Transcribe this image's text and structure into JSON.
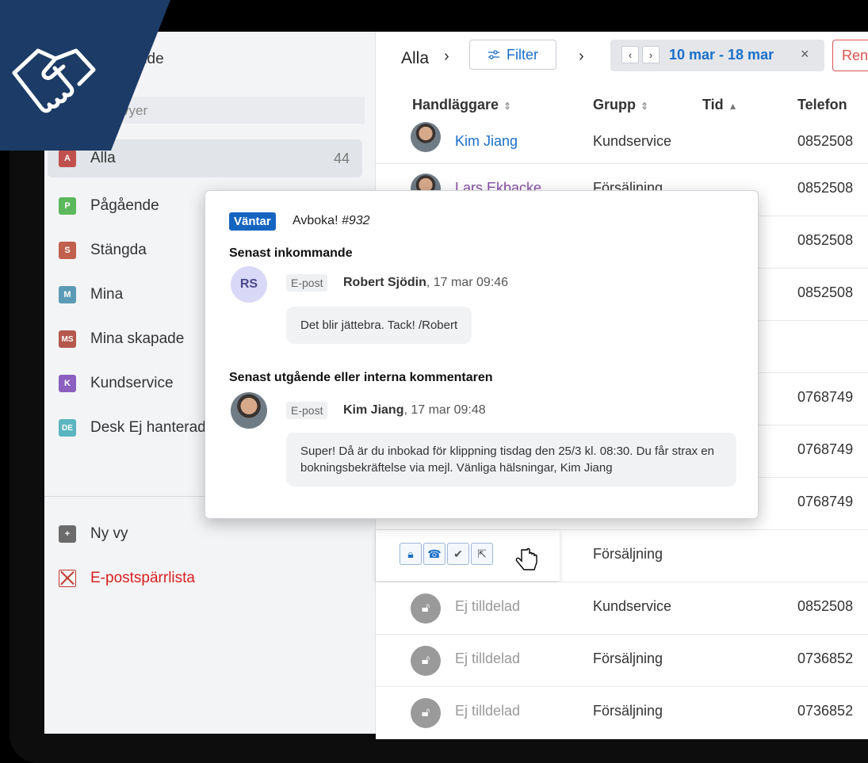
{
  "sidebar": {
    "title": "Pågående",
    "search_placeholder": "Sök vyer",
    "items": [
      {
        "badge": "A",
        "label": "Alla",
        "count": "44",
        "color": "#c0504d"
      },
      {
        "badge": "P",
        "label": "Pågående",
        "color": "#5cb85c"
      },
      {
        "badge": "S",
        "label": "Stängda",
        "color": "#c0604d"
      },
      {
        "badge": "M",
        "label": "Mina",
        "color": "#5b9bb5"
      },
      {
        "badge": "MS",
        "label": "Mina skapade",
        "color": "#b5574d"
      },
      {
        "badge": "K",
        "label": "Kundservice",
        "color": "#8a5fc0"
      },
      {
        "badge": "DE",
        "label": "Desk Ej hanterad",
        "color": "#5bb5c0"
      }
    ],
    "new_view_label": "Ny vy",
    "new_view_badge": "+",
    "blocklist_label": "E-postspärrlista"
  },
  "header": {
    "crumb": "Alla",
    "filter_label": "Filter",
    "date_range": "10 mar - 18 mar",
    "clear_label": "Rensa"
  },
  "table": {
    "columns": [
      "Handläggare",
      "Grupp",
      "Tid",
      "Telefon"
    ],
    "rows": [
      {
        "agent": "Kim Jiang",
        "group": "Kundservice",
        "phone": "0852508"
      },
      {
        "agent": "Lars Ekbacke",
        "group": "Försäljning",
        "phone": "0852508"
      },
      {
        "agent": "",
        "group": "",
        "phone": "0852508"
      },
      {
        "agent": "",
        "group": "",
        "phone": "0852508"
      },
      {
        "agent": "",
        "group": "",
        "phone": ""
      },
      {
        "agent": "",
        "group": "",
        "phone": "0768749"
      },
      {
        "agent": "",
        "group": "",
        "phone": "0768749"
      },
      {
        "agent": "",
        "group": "",
        "phone": "0768749"
      },
      {
        "agent": "",
        "group": "Försäljning",
        "phone": ""
      },
      {
        "agent": "Ej tilldelad",
        "group": "Kundservice",
        "phone": "0852508"
      },
      {
        "agent": "Ej tilldelad",
        "group": "Försäljning",
        "phone": "0736852"
      },
      {
        "agent": "Ej tilldelad",
        "group": "Försäljning",
        "phone": "0736852"
      }
    ]
  },
  "popover": {
    "status": "Väntar",
    "subject": "Avboka!",
    "ticket_no": "#932",
    "incoming_heading": "Senast inkommande",
    "incoming": {
      "initials": "RS",
      "channel": "E-post",
      "author": "Robert Sjödin",
      "time": ", 17 mar 09:46",
      "message": "Det blir jättebra. Tack!  /Robert"
    },
    "outgoing_heading": "Senast utgående eller interna kommentaren",
    "outgoing": {
      "channel": "E-post",
      "author": "Kim Jiang",
      "time": ", 17 mar 09:48",
      "message": "Super! Då är du inbokad för klippning tisdag den 25/3 kl. 08:30. Du får strax en bokningsbekräftelse via mejl. Vänliga hälsningar, Kim Jiang"
    }
  },
  "colors": {
    "accent": "#1a6fc9",
    "status_badge": "#1565c0",
    "danger": "#d9534f",
    "logo_bg": "#1c3b66"
  }
}
